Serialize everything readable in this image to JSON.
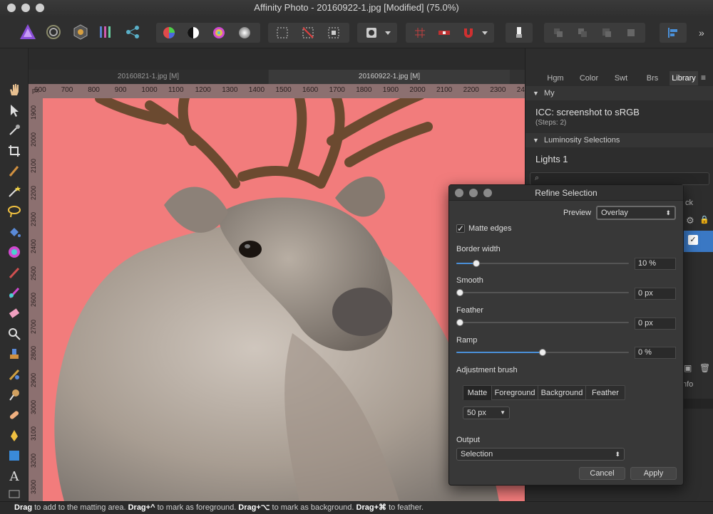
{
  "window": {
    "title": "Affinity Photo - 20160922-1.jpg [Modified] (75.0%)"
  },
  "toolbar": {
    "icons": [
      "affinity-photo-persona-icon",
      "liquify-persona-icon",
      "develop-persona-icon",
      "tone-mapping-persona-icon",
      "export-persona-icon",
      "color-wheel-icon",
      "contrast-icon",
      "hsl-icon",
      "gradient-icon",
      "marquee-icon",
      "deselect-icon",
      "invert-selection-icon",
      "quick-mask-icon",
      "grid-icon",
      "snapping-icon",
      "magnet-icon",
      "inpaint-icon",
      "arrange-icon",
      "align-icon"
    ]
  },
  "document_tabs": [
    {
      "label": "20160821-1.jpg [M]"
    },
    {
      "label": "20160922-1.jpg [M]"
    }
  ],
  "ruler": {
    "unit": "px",
    "h_ticks": [
      "600",
      "700",
      "800",
      "900",
      "1000",
      "1100",
      "1200",
      "1300",
      "1400",
      "1500",
      "1600",
      "1700",
      "1800",
      "1900",
      "2000",
      "2100",
      "2200",
      "2300",
      "2400"
    ],
    "v_ticks": [
      "1900",
      "2000",
      "2100",
      "2200",
      "2300",
      "2400",
      "2500",
      "2600",
      "2700",
      "2800",
      "2900",
      "3000",
      "3100",
      "3200",
      "3300"
    ]
  },
  "right_panel": {
    "tabs": [
      {
        "label": "Hgm"
      },
      {
        "label": "Color"
      },
      {
        "label": "Swt"
      },
      {
        "label": "Brs"
      },
      {
        "label": "Library"
      }
    ],
    "my_section": "My",
    "macro_name": "ICC: screenshot to sRGB",
    "macro_steps": "(Steps: 2)",
    "luminosity_section": "Luminosity Selections",
    "lights_item": "Lights 1",
    "partial_text_1": "ck",
    "partial_text_2": "nfo"
  },
  "dialog": {
    "title": "Refine Selection",
    "preview_label": "Preview",
    "preview_value": "Overlay",
    "matte_edges_label": "Matte edges",
    "matte_edges_checked": true,
    "border_width_label": "Border width",
    "border_width_value": "10 %",
    "border_width_fraction": 0.1,
    "smooth_label": "Smooth",
    "smooth_value": "0 px",
    "smooth_fraction": 0,
    "feather_label": "Feather",
    "feather_value": "0 px",
    "feather_fraction": 0,
    "ramp_label": "Ramp",
    "ramp_value": "0 %",
    "ramp_fraction": 0.5,
    "adjustment_brush_label": "Adjustment brush",
    "brush_modes": [
      "Matte",
      "Foreground",
      "Background",
      "Feather"
    ],
    "brush_size": "50 px",
    "output_label": "Output",
    "output_value": "Selection",
    "cancel_label": "Cancel",
    "apply_label": "Apply"
  },
  "status": {
    "drag_1": "Drag",
    "text_1": " to add to the matting area. ",
    "drag_2": "Drag+^",
    "text_2": " to mark as foreground. ",
    "drag_3": "Drag+⌥",
    "text_3": " to mark as background. ",
    "drag_4": "Drag+⌘",
    "text_4": " to feather."
  },
  "colors": {
    "canvas_background": "#f27c7c",
    "accent": "#4a90d9"
  }
}
